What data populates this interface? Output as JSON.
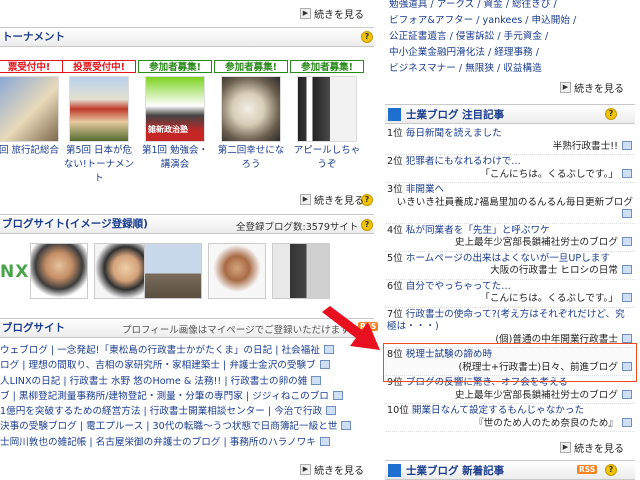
{
  "more_label": "続きを見る",
  "left": {
    "tournament": {
      "title": "トーナメント",
      "cards": [
        {
          "badge": "票受付中!",
          "badge_color": "red",
          "text": "旅行記総合"
        },
        {
          "badge": "投票受付中!",
          "badge_color": "red",
          "text": "第5回 日本が危ない!トーナメント"
        },
        {
          "badge": "参加者募集!",
          "badge_color": "green",
          "text": "第1回 勉強会・講演会"
        },
        {
          "badge": "参加者募集!",
          "badge_color": "green",
          "text": "第二回幸せになろう"
        },
        {
          "badge": "参加者募集!",
          "badge_color": "green",
          "text": "アピールしちゃうぞ"
        }
      ],
      "card_prefix_1": "回",
      "green_card_caption": "雑新政治塾"
    },
    "image_blogs": {
      "title": "ブログサイト(イメージ登録順)",
      "count_label": "全登録ブログ数:3579サイト",
      "logo_text": "NX"
    },
    "profile_blogs": {
      "title": "ブログサイト",
      "note": "プロフィール画像はマイページでご登録いただけます",
      "rss": "RSS",
      "lines": [
        "ウェブログ | 一念発起!「東松島の行政書士かがたくま」の日記 | 社会福祉",
        "ログ | 理想の間取り、吉相の家研究所・家相建築士 | 弁護士金沢の受験ブ",
        "人LINXの日記 | 行政書士 水野 悠のHome & 法務!! | 行政書士の卵の雑",
        "ブ | 黒柳登記測量事務所/建物登記・測量・分筆の専門家 | ジジィねこのブロ",
        "1億円を突破するための経営方法 | 行政書士開業相談センター | 今治で行政",
        "決事の受験ブログ | 電工プルース | 30代の転職〜うつ状態で日商簿記一級と世",
        "士岡川敦也の雑記帳 | 名古屋栄御の弁護士のブログ | 事務所のハラノワキ"
      ]
    }
  },
  "right": {
    "categories": [
      "勉強道具 / アークス / 資金 / 総往きび /",
      "ビフォア&アフター / yankees / 申込開始 /",
      "公正証書遺言 / 侵害訴訟 / 手元資金 /",
      "中小企業金融円滑化法 / 経理事務 /",
      "ビジネスマナー / 無限狭 / 収益構造"
    ],
    "featured": {
      "title": "士業ブログ 注目記事",
      "items": [
        {
          "rank": "1位",
          "title": "毎日新聞を読えました",
          "author": "半熟行政書士!!"
        },
        {
          "rank": "2位",
          "title": "犯罪者にもなれるわけで…",
          "author": "「こんにちは。くるぶしです。」"
        },
        {
          "rank": "3位",
          "title": "非開業へ",
          "author": "いきいき社員養成♪福島里加のるんるん毎日更新ブログ"
        },
        {
          "rank": "4位",
          "title": "私が同業者を「先生」と呼ぶワケ",
          "author": "史上最年少宮部長鎖補社労士のブログ"
        },
        {
          "rank": "5位",
          "title": "ホームページの出来はよくないが一旦UPします",
          "author": "大阪の行政書士 ヒロシの日常"
        },
        {
          "rank": "6位",
          "title": "自分でやっちゃってた…",
          "author": "「こんにちは。くるぶしです。」"
        },
        {
          "rank": "7位",
          "title": "行政書士の使命って?(考え方はそれぞれだけど、究極は・・・)",
          "author": "(個)普通の中年開業行政書士"
        },
        {
          "rank": "8位",
          "title": "税理士試験の諦め時",
          "author": "(税理士+行政書士)日々、前進ブログ"
        },
        {
          "rank": "9位",
          "title": "ブログの反響に驚き、オフ会を考える",
          "author": "史上最年少宮部長鎖補社労士のブログ"
        },
        {
          "rank": "10位",
          "title": "開業日なんて設定するもんじゃなかった",
          "author": "『世のため人のため奈良のため』"
        }
      ]
    },
    "new_articles": {
      "title": "士業ブログ 新着記事",
      "rss": "RSS"
    }
  }
}
